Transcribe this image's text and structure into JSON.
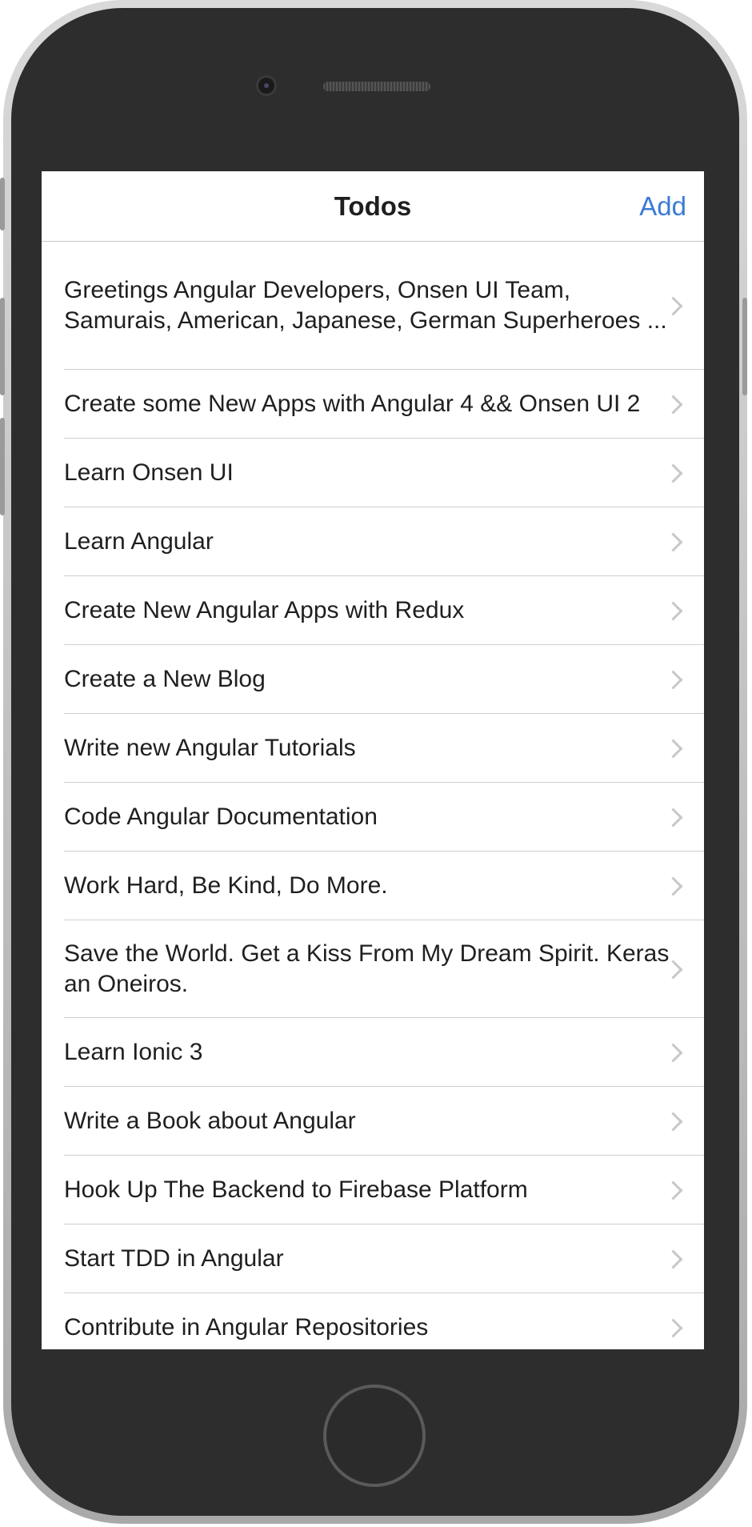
{
  "toolbar": {
    "title": "Todos",
    "add_label": "Add"
  },
  "todos": [
    {
      "text": "Greetings Angular Developers, Onsen UI Team, Samurais, American, Japanese, German Superheroes ..."
    },
    {
      "text": "Create some New Apps with Angular 4 && Onsen UI 2"
    },
    {
      "text": "Learn Onsen UI"
    },
    {
      "text": "Learn Angular"
    },
    {
      "text": "Create New Angular Apps with Redux"
    },
    {
      "text": "Create a New Blog"
    },
    {
      "text": "Write new Angular Tutorials"
    },
    {
      "text": "Code Angular Documentation"
    },
    {
      "text": "Work Hard, Be Kind, Do More."
    },
    {
      "text": "Save the World. Get a Kiss From My Dream Spirit. Keras an Oneiros."
    },
    {
      "text": "Learn Ionic 3"
    },
    {
      "text": "Write a Book about Angular"
    },
    {
      "text": "Hook Up The Backend to Firebase Platform"
    },
    {
      "text": "Start TDD in Angular"
    },
    {
      "text": "Contribute in Angular Repositories"
    }
  ],
  "icons": {
    "chevron": "chevron-right-icon",
    "camera": "camera-icon",
    "speaker": "speaker-icon",
    "home": "home-button"
  },
  "colors": {
    "accent": "#3a7bd5",
    "text": "#1f1f21",
    "chevron": "#c7c7cc",
    "divider": "#cfcfcf"
  }
}
